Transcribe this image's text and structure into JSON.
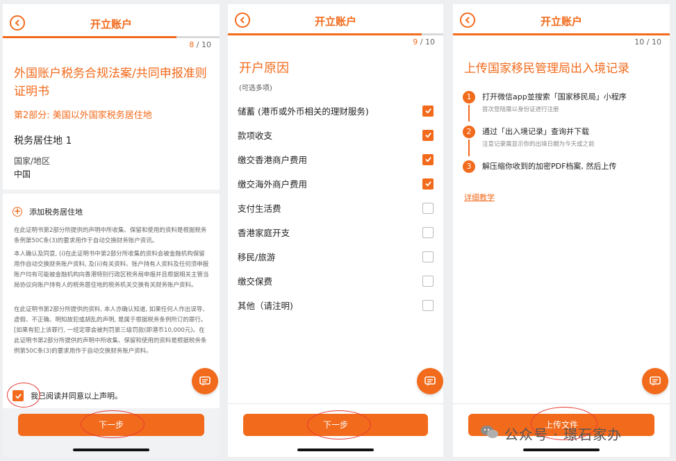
{
  "colors": {
    "accent": "#f26a1b",
    "mark": "#e53935"
  },
  "screens": [
    {
      "title": "开立账户",
      "step_current": "8",
      "step_total": "/ 10",
      "progress": 0.8,
      "heading": "外国账户税务合规法案/共同申报准则证明书",
      "section": "第2部分: 美国以外国家税务居住地",
      "residence_label": "税务居住地 1",
      "country_label": "国家/地区",
      "country_value": "中国",
      "add_residence": "添加税务居住地",
      "paragraphs": [
        "在此证明书第2部分所提供的声明中所收集、保留和使用的资料是根据税务条例第50C条(3)的要求用作于自动交换财务账户资讯。",
        "本人确认及同意, (i)在此证明书中第2部分所收集的资料会被金融机构保留用作自动交换财务账户资料, 及(ii)有关资料、账户持有人资料及任何须申报账户均有可能被金融机构向香港特别行政区税务局申报并且根据相关主管当局协议向账户持有人的税务居住地的税务机关交换有关财务账户资料。",
        "在此证明书第2部分所提供的资料, 本人亦确认知道, 如果任何人作出误导、虚假、不正确、明知故犯或胡乱的声明, 是属于根据税务条例所订的罪行。[如果有犯上该罪行, 一经定罪会被判罚第三级罚款(即港币10,000元)。在此证明书第2部分所提供的声明中所收集、保留和使用的资料是根据税务条例第50C条(3)的要求用作于自动交换财务账户资料。"
      ],
      "agree_label": "我已阅读并同意以上声明。",
      "agree_checked": true,
      "next_label": "下一步",
      "icons": [
        "back-icon",
        "plus-icon",
        "chat-icon",
        "check-icon"
      ]
    },
    {
      "title": "开立账户",
      "step_current": "9",
      "step_total": "/ 10",
      "progress": 0.9,
      "heading": "开户原因",
      "hint": "(可选多项)",
      "options": [
        {
          "label": "储蓄 (港币或外币相关的理财服务)",
          "checked": true
        },
        {
          "label": "款项收支",
          "checked": true
        },
        {
          "label": "缴交香港商户费用",
          "checked": true
        },
        {
          "label": "缴交海外商户费用",
          "checked": true
        },
        {
          "label": "支付生活费",
          "checked": false
        },
        {
          "label": "香港家庭开支",
          "checked": false
        },
        {
          "label": "移民/旅游",
          "checked": false
        },
        {
          "label": "缴交保费",
          "checked": false
        },
        {
          "label": "其他（请注明)",
          "checked": false
        }
      ],
      "next_label": "下一步",
      "icons": [
        "back-icon",
        "chat-icon",
        "check-icon"
      ]
    },
    {
      "title": "开立账户",
      "step_current": "10",
      "step_total": "/ 10",
      "progress": 1.0,
      "heading": "上传国家移民管理局出入境记录",
      "steps": [
        {
          "num": "1",
          "title": "打开微信app並搜索「国家移民局」小程序",
          "desc": "首次登陆需以身份证进行注册"
        },
        {
          "num": "2",
          "title": "通过「出入境记录」查询并下载",
          "desc": "注意记录需显示你的出境日期为今天或之前"
        },
        {
          "num": "3",
          "title": "解压缩你收到的加密PDF档案, 然后上传",
          "desc": ""
        }
      ],
      "link_label": "详细教学",
      "upload_label": "上传文件",
      "icons": [
        "back-icon",
        "chat-icon"
      ]
    }
  ],
  "watermark": "公众号 · 璟石家办"
}
